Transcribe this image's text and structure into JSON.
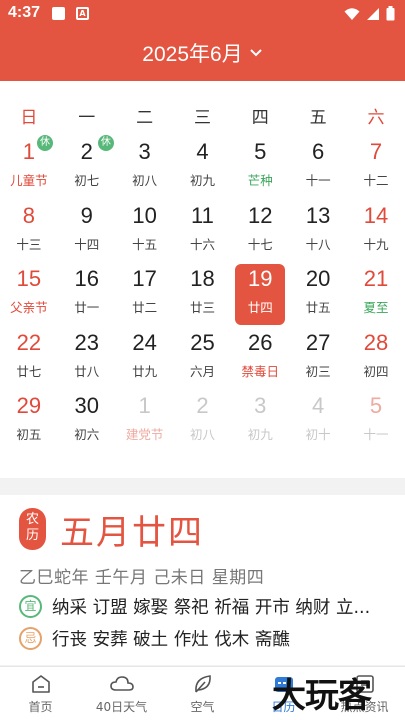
{
  "status_bar": {
    "time": "4:37",
    "notif_a": "A"
  },
  "header": {
    "title": "2025年6月"
  },
  "weekdays": [
    "日",
    "一",
    "二",
    "三",
    "四",
    "五",
    "六"
  ],
  "calendar": {
    "rows": [
      [
        {
          "day": "1",
          "sub": "儿童节",
          "sub_style": "red",
          "rest": "休"
        },
        {
          "day": "2",
          "sub": "初七",
          "rest": "休"
        },
        {
          "day": "3",
          "sub": "初八"
        },
        {
          "day": "4",
          "sub": "初九"
        },
        {
          "day": "5",
          "sub": "芒种",
          "sub_style": "green"
        },
        {
          "day": "6",
          "sub": "十一"
        },
        {
          "day": "7",
          "sub": "十二"
        }
      ],
      [
        {
          "day": "8",
          "sub": "十三"
        },
        {
          "day": "9",
          "sub": "十四"
        },
        {
          "day": "10",
          "sub": "十五"
        },
        {
          "day": "11",
          "sub": "十六"
        },
        {
          "day": "12",
          "sub": "十七"
        },
        {
          "day": "13",
          "sub": "十八"
        },
        {
          "day": "14",
          "sub": "十九"
        }
      ],
      [
        {
          "day": "15",
          "sub": "父亲节",
          "sub_style": "red"
        },
        {
          "day": "16",
          "sub": "廿一"
        },
        {
          "day": "17",
          "sub": "廿二"
        },
        {
          "day": "18",
          "sub": "廿三"
        },
        {
          "day": "19",
          "sub": "廿四",
          "today": true
        },
        {
          "day": "20",
          "sub": "廿五"
        },
        {
          "day": "21",
          "sub": "夏至",
          "sub_style": "green"
        }
      ],
      [
        {
          "day": "22",
          "sub": "廿七"
        },
        {
          "day": "23",
          "sub": "廿八"
        },
        {
          "day": "24",
          "sub": "廿九"
        },
        {
          "day": "25",
          "sub": "六月"
        },
        {
          "day": "26",
          "sub": "禁毒日",
          "sub_style": "red"
        },
        {
          "day": "27",
          "sub": "初三"
        },
        {
          "day": "28",
          "sub": "初四"
        }
      ],
      [
        {
          "day": "29",
          "sub": "初五"
        },
        {
          "day": "30",
          "sub": "初六"
        },
        {
          "day": "1",
          "sub": "建党节",
          "sub_style": "red",
          "faded": true
        },
        {
          "day": "2",
          "sub": "初八",
          "faded": true
        },
        {
          "day": "3",
          "sub": "初九",
          "faded": true
        },
        {
          "day": "4",
          "sub": "初十",
          "faded": true
        },
        {
          "day": "5",
          "sub": "十一",
          "faded": true
        }
      ]
    ]
  },
  "lunar": {
    "seal": [
      "农",
      "历"
    ],
    "date": "五月廿四",
    "ganzhi": "乙巳蛇年 壬午月 己未日 星期四",
    "yi_label": "宜",
    "yi": "纳采 订盟 嫁娶 祭祀 祈福 开市 纳财 立...",
    "ji_label": "忌",
    "ji": "行丧 安葬 破土 作灶 伐木 斋醮"
  },
  "nav": {
    "items": [
      {
        "label": "首页",
        "icon": "home-icon"
      },
      {
        "label": "40日天气",
        "icon": "cloud-icon"
      },
      {
        "label": "空气",
        "icon": "leaf-icon"
      },
      {
        "label": "日历",
        "icon": "calendar-icon",
        "active": true
      },
      {
        "label": "热点资讯",
        "icon": "news-icon"
      }
    ]
  },
  "watermark": {
    "text": "大玩客"
  },
  "colors": {
    "accent": "#e35540",
    "green": "#58b87a",
    "orange": "#e5a36c",
    "active_nav": "#2f7bd8"
  }
}
